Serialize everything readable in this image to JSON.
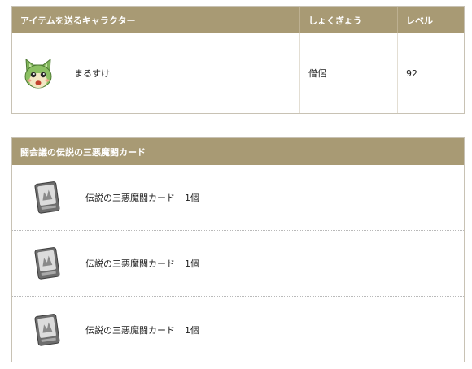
{
  "character_table": {
    "headers": {
      "character": "アイテムを送るキャラクター",
      "job": "しょくぎょう",
      "level": "レベル"
    },
    "row": {
      "name": "まるすけ",
      "job": "僧侶",
      "level": "92"
    }
  },
  "card_table": {
    "header": "闘会議の伝説の三悪魔闘カード",
    "items": [
      {
        "name": "伝説の三悪魔闘カード",
        "quantity": "1個"
      },
      {
        "name": "伝説の三悪魔闘カード",
        "quantity": "1個"
      },
      {
        "name": "伝説の三悪魔闘カード",
        "quantity": "1個"
      }
    ]
  },
  "colors": {
    "header_bg": "#a89a74",
    "border": "#c8c2b4"
  },
  "icons": {
    "avatar": "green-cat-avatar-icon",
    "card": "monster-card-icon"
  }
}
